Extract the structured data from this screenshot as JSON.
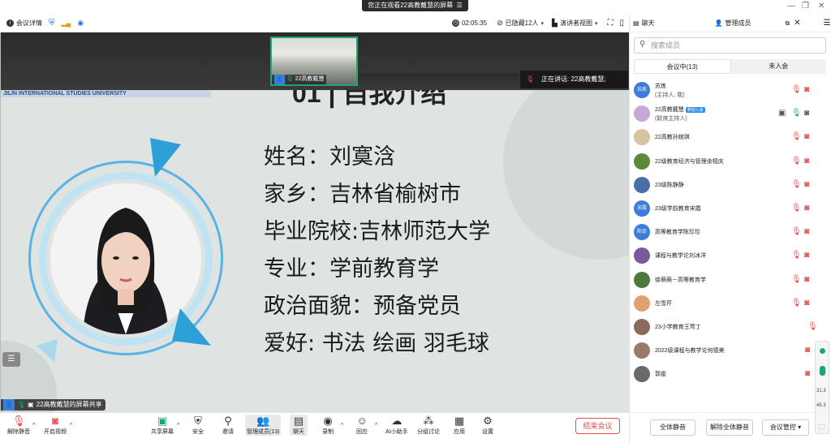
{
  "window": {
    "banner": "您正在观看22高教戴慧的屏幕",
    "banner_icon": "menu-icon"
  },
  "toolbar": {
    "meeting_details": "会议详情",
    "timer": "02:05:35",
    "hidden_people": "已隐藏12人",
    "view_mode": "演讲者视图"
  },
  "stage": {
    "thumb_name": "22高教戴慧",
    "speaking_label": "正在讲话:",
    "speaking_name": "22高教戴慧;",
    "university": "JILIN INTERNATIONAL STUDIES UNIVERSITY",
    "slide_heading": "01 | 自我介绍",
    "info_lines": [
      "姓名：刘寞浛",
      "家乡：吉林省榆树市",
      "毕业院校:吉林师范大学",
      "专业：学前教育学",
      "政治面貌：预备党员",
      "爱好: 书法  绘画   羽毛球"
    ],
    "share_tag": "22高教戴慧的屏幕共享",
    "accent_color": "#3b9fd8"
  },
  "bottombar": {
    "unmute": "解除静音",
    "start_video": "开启视频",
    "share_screen": "共享屏幕",
    "security": "安全",
    "invite": "邀请",
    "manage_members": "管理成员(13)",
    "chat": "聊天",
    "record": "录制",
    "reactions": "回应",
    "ai_assistant": "AI小助手",
    "breakout": "分组讨论",
    "apps": "应用",
    "settings": "设置",
    "end_meeting": "结束会议"
  },
  "panel": {
    "chat_tab": "聊天",
    "members_tab": "管理成员",
    "search_placeholder": "搜索成员",
    "in_meeting": "会议中(13)",
    "not_joined": "未入会",
    "members": [
      {
        "avatar": "苏炼",
        "name": "苏炼",
        "sub": "(主持人, 我)",
        "color": "#3b7dd8"
      },
      {
        "avatar": "",
        "name": "22高教戴慧",
        "badge": "参加入会",
        "sub": "(联席主持人)",
        "color": "#c8a8d8"
      },
      {
        "avatar": "",
        "name": "22高教孙婉琪",
        "color": "#d9c3a0"
      },
      {
        "avatar": "",
        "name": "22级教育经济与管理余桓庆",
        "color": "#5d8a3a"
      },
      {
        "avatar": "",
        "name": "23级陈静静",
        "color": "#4a6fa8"
      },
      {
        "avatar": "宋霞",
        "name": "23级学前教育宋霞",
        "color": "#3b7dd8"
      },
      {
        "avatar": "陈珍",
        "name": "高等教育学陈珍珍",
        "color": "#3b7dd8"
      },
      {
        "avatar": "",
        "name": "课程与教学论刘冰洋",
        "color": "#7a5a9a"
      },
      {
        "avatar": "",
        "name": "徐萌萌－高等教育学",
        "color": "#4c7a3c"
      },
      {
        "avatar": "",
        "name": "左雪芹",
        "color": "#e0a070"
      },
      {
        "avatar": "",
        "name": "23小学教育王莺丁",
        "color": "#8a6a5a"
      },
      {
        "avatar": "",
        "name": "2022级课程与教学论何德美",
        "color": "#9a7a6a"
      },
      {
        "avatar": "",
        "name": "郭俊",
        "color": "#6a6a6a"
      }
    ],
    "mute_all": "全体静音",
    "unmute_all": "解除全体静音",
    "meeting_control": "会议管控"
  },
  "float": {
    "v1": "31.3",
    "v2": "45.3"
  }
}
